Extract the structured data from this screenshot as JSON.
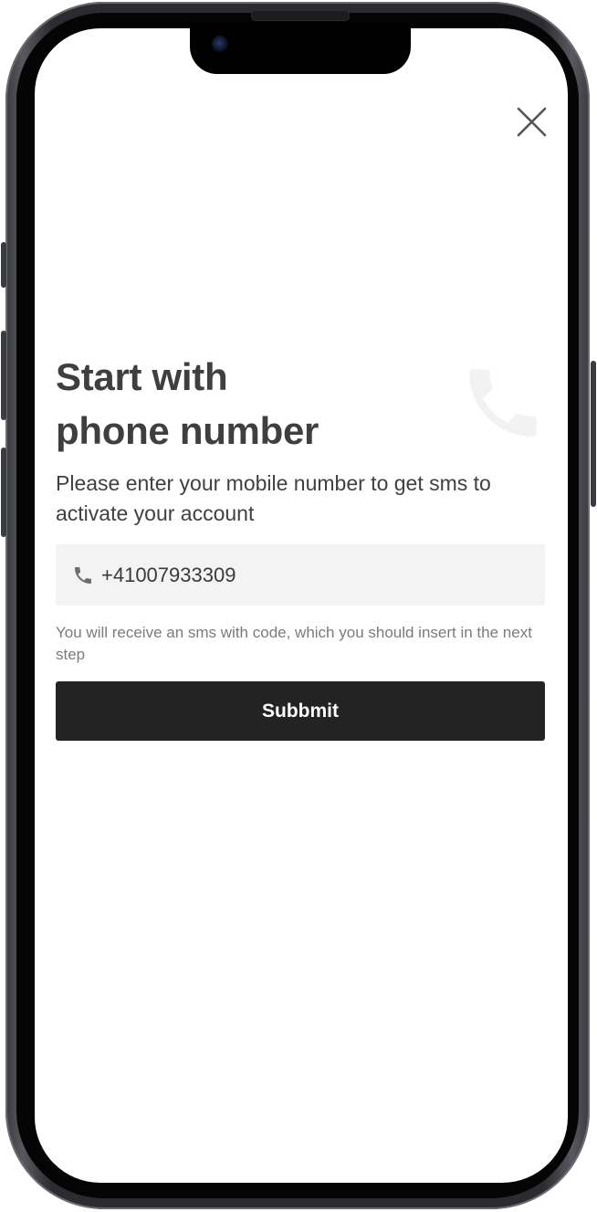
{
  "header": {
    "close_icon": "close-icon"
  },
  "decoration": {
    "background_icon": "phone-icon"
  },
  "main": {
    "title_line1": "Start with",
    "title_line2": "phone number",
    "subtitle": "Please enter your mobile number to get sms to activate your account",
    "phone_field": {
      "icon": "phone-icon",
      "value": "+41007933309"
    },
    "hint": "You will receive an sms with code, which you should insert in the next step",
    "submit_label": "Subbmit"
  },
  "colors": {
    "title": "#3f3f3f",
    "button_bg": "#232323",
    "button_text": "#ffffff",
    "field_bg": "#f3f3f3",
    "hint": "#7b7b7b"
  }
}
